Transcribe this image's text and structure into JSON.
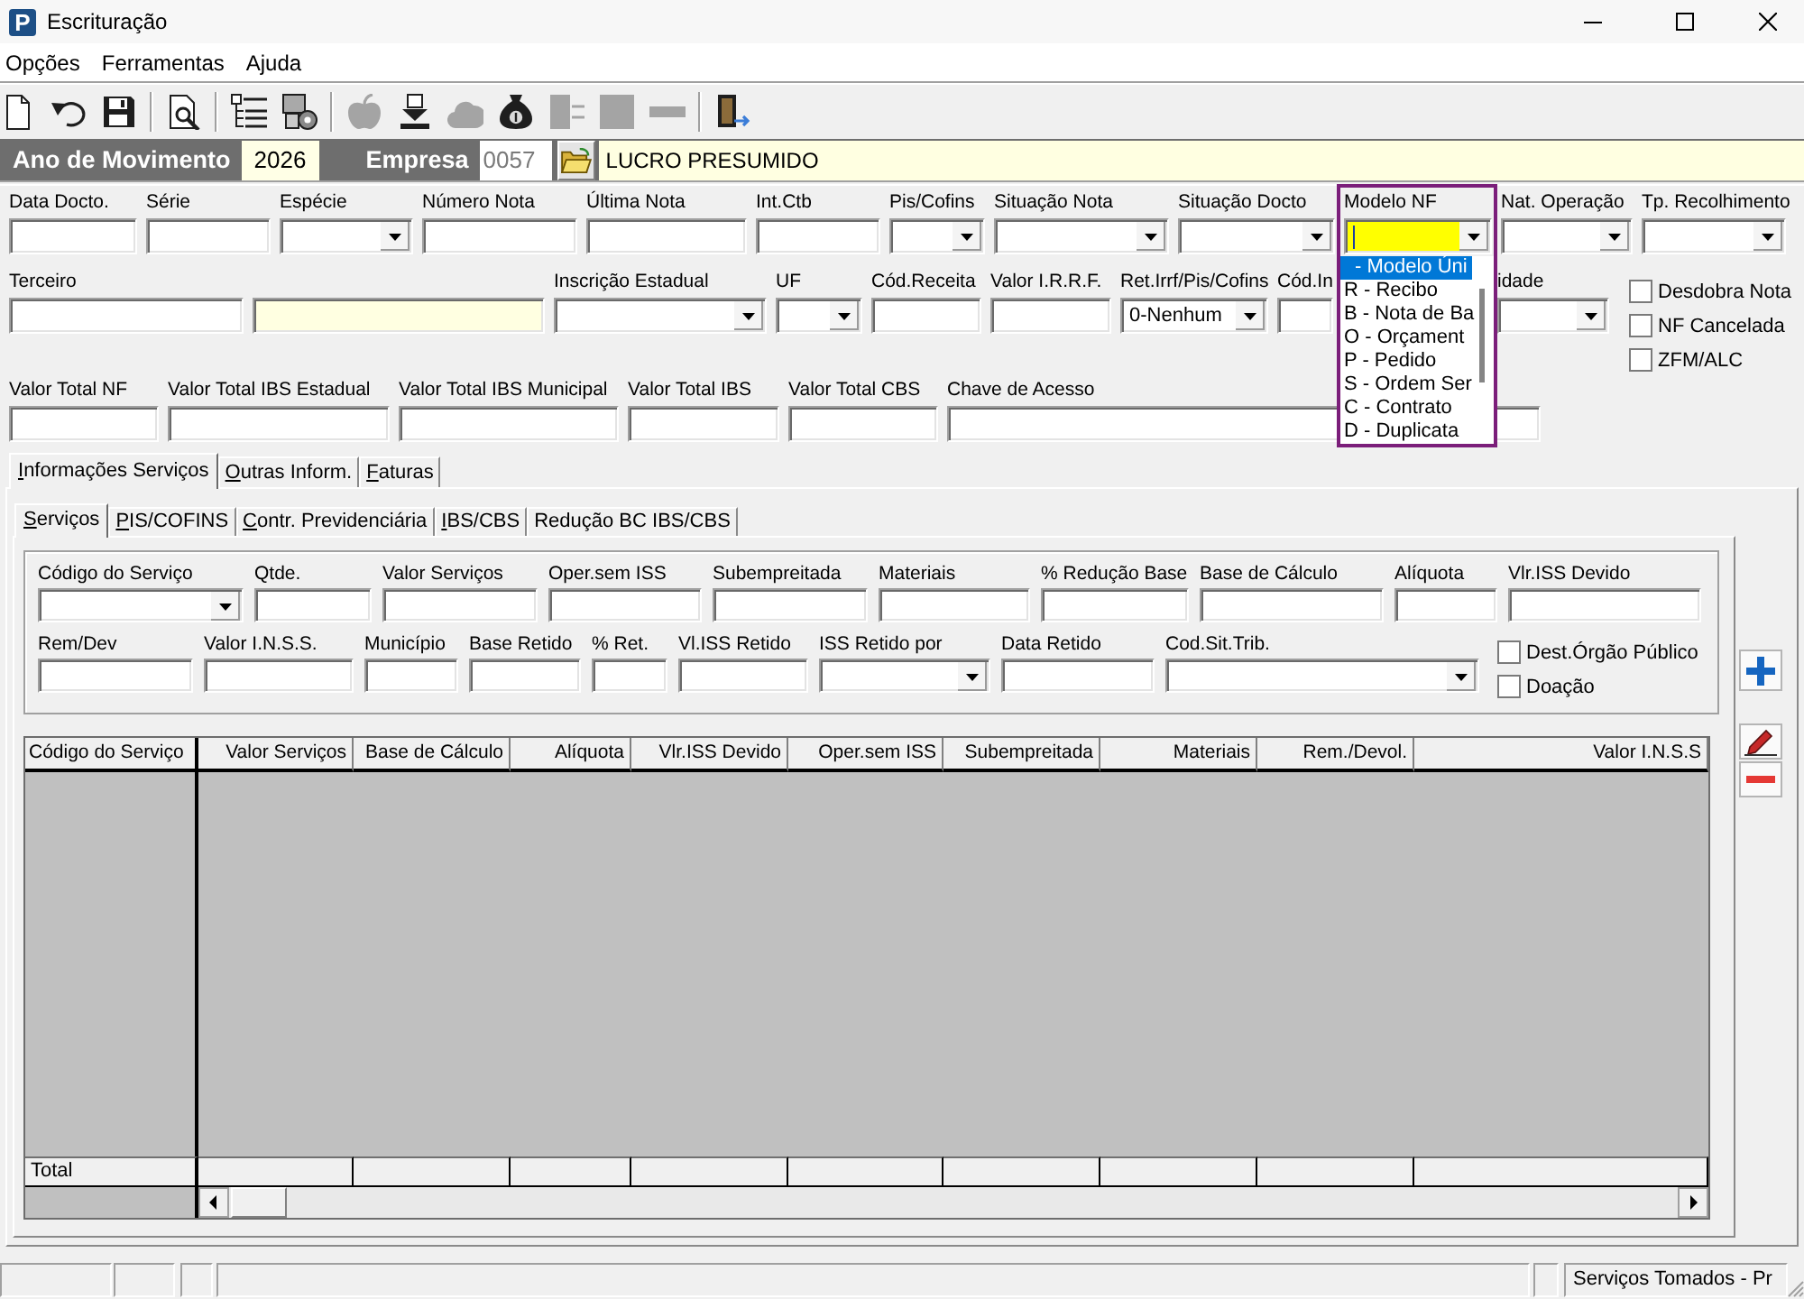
{
  "window": {
    "logo_text": "P",
    "title": "Escrituração"
  },
  "menu": [
    "Opções",
    "Ferramentas",
    "Ajuda"
  ],
  "toolbar": [
    [
      {
        "disabled": false
      },
      {
        "disabled": false
      },
      {
        "disabled": false
      }
    ],
    [
      {
        "disabled": false
      }
    ],
    [
      {
        "disabled": false
      },
      {
        "disabled": false
      }
    ],
    [
      {
        "disabled": true
      },
      {
        "disabled": false
      },
      {
        "disabled": true
      },
      {
        "disabled": false
      },
      {
        "disabled": true
      },
      {
        "disabled": true
      },
      {
        "disabled": true
      }
    ],
    [
      {
        "disabled": false
      }
    ]
  ],
  "header": {
    "year_label": "Ano de Movimento",
    "year": "2026",
    "company_label": "Empresa",
    "company_code": {
      "value": "0057",
      "disabled": true
    },
    "company_name": "LUCRO PRESUMIDO"
  },
  "form": {
    "row_1": [
      {
        "label": "Data Docto.",
        "kind": "text",
        "focused": false
      },
      {
        "label": "Série",
        "kind": "text",
        "focused": false
      },
      {
        "label": "Espécie",
        "kind": "combo",
        "focused": false
      },
      {
        "label": "Número Nota",
        "kind": "text",
        "focused": false
      },
      {
        "label": "Última Nota",
        "kind": "text",
        "focused": false
      },
      {
        "label": "Int.Ctb",
        "kind": "text",
        "focused": false
      },
      {
        "label": "Pis/Cofins",
        "kind": "combo",
        "focused": false
      },
      {
        "label": "Situação Nota",
        "kind": "combo",
        "focused": false
      },
      {
        "label": "Situação Docto",
        "kind": "combo",
        "focused": false
      },
      {
        "label": "Modelo NF",
        "kind": "combo",
        "focused": true,
        "list": {
          "framed": true,
          "options": [
            {
              "label": "- Modelo Úni",
              "selected": true
            },
            {
              "label": "R - Recibo",
              "selected": false
            },
            {
              "label": "B - Nota de Ba",
              "selected": false
            },
            {
              "label": "O - Orçament",
              "selected": false
            },
            {
              "label": "P - Pedido",
              "selected": false
            },
            {
              "label": "S - Ordem Ser",
              "selected": false
            },
            {
              "label": "C - Contrato",
              "selected": false
            },
            {
              "label": "D - Duplicata",
              "selected": false
            }
          ]
        }
      },
      {
        "label": "Nat. Operação",
        "kind": "combo",
        "focused": false
      },
      {
        "label": "Tp. Recolhimento",
        "kind": "combo",
        "focused": false
      }
    ],
    "row_2": [
      {
        "label": "Terceiro",
        "kind": "text",
        "focused": false
      },
      {
        "kind": "display",
        "focused": false
      },
      {
        "label": "Inscrição Estadual",
        "kind": "combo",
        "focused": false
      },
      {
        "label": "UF",
        "kind": "combo",
        "focused": false
      },
      {
        "label": "Cód.Receita",
        "kind": "text",
        "focused": false
      },
      {
        "label": "Valor I.R.R.F.",
        "kind": "text",
        "focused": false
      },
      {
        "label": "Ret.Irrf/Pis/Cofins",
        "kind": "combo",
        "value": "0-Nenhum",
        "focused": false
      },
      {
        "label": "Cód.In",
        "kind": "text",
        "focused": false
      },
      {
        "label": "idade",
        "kind": "combo",
        "focused": false
      }
    ],
    "flags": [
      {
        "label": "Desdobra Nota",
        "checked": false
      },
      {
        "label": "NF Cancelada",
        "checked": false
      },
      {
        "label": "ZFM/ALC",
        "checked": false
      }
    ],
    "row_3": [
      {
        "label": "Valor Total NF",
        "kind": "text",
        "focused": false
      },
      {
        "label": "Valor Total IBS Estadual",
        "kind": "text",
        "focused": false
      },
      {
        "label": "Valor Total IBS Municipal",
        "kind": "text",
        "focused": false
      },
      {
        "label": "Valor Total IBS",
        "kind": "text",
        "focused": false
      },
      {
        "label": "Valor Total CBS",
        "kind": "text",
        "focused": false
      },
      {
        "label": "Chave de Acesso",
        "kind": "text",
        "focused": false
      }
    ]
  },
  "tabs": [
    {
      "label": "Informações Serviços",
      "selected": true,
      "hotkey": true
    },
    {
      "label": "Outras Inform.",
      "selected": false,
      "hotkey": true
    },
    {
      "label": "Faturas",
      "selected": false,
      "hotkey": true
    }
  ],
  "sub_tabs": [
    {
      "label": "Serviços",
      "selected": true,
      "hotkey": true
    },
    {
      "label": "PIS/COFINS",
      "selected": false,
      "hotkey": true
    },
    {
      "label": "Contr. Previdenciária",
      "selected": false,
      "hotkey": true
    },
    {
      "label": "IBS/CBS",
      "selected": false,
      "hotkey": true
    },
    {
      "label": "Redução BC IBS/CBS",
      "selected": false,
      "hotkey": false
    }
  ],
  "service_form": {
    "row_1": [
      {
        "label": "Código do Serviço",
        "kind": "combo"
      },
      {
        "label": "Qtde.",
        "kind": "text"
      },
      {
        "label": "Valor Serviços",
        "kind": "text"
      },
      {
        "label": "Oper.sem ISS",
        "kind": "text"
      },
      {
        "label": "Subempreitada",
        "kind": "text"
      },
      {
        "label": "Materiais",
        "kind": "text"
      },
      {
        "label": "% Redução Base",
        "kind": "text"
      },
      {
        "label": "Base de Cálculo",
        "kind": "text"
      },
      {
        "label": "Alíquota",
        "kind": "text"
      },
      {
        "label": "Vlr.ISS Devido",
        "kind": "text"
      }
    ],
    "row_2": [
      {
        "label": "Rem/Dev",
        "kind": "text"
      },
      {
        "label": "Valor I.N.S.S.",
        "kind": "text"
      },
      {
        "label": "Município",
        "kind": "text"
      },
      {
        "label": "Base Retido",
        "kind": "text"
      },
      {
        "label": "% Ret.",
        "kind": "text"
      },
      {
        "label": "Vl.ISS Retido",
        "kind": "text"
      },
      {
        "label": "ISS Retido por",
        "kind": "combo"
      },
      {
        "label": "Data Retido",
        "kind": "text"
      },
      {
        "label": "Cod.Sit.Trib.",
        "kind": "combo"
      }
    ],
    "flags": [
      {
        "label": "Dest.Órgão Público",
        "checked": false
      },
      {
        "label": "Doação",
        "checked": false
      }
    ]
  },
  "grid": {
    "columns": [
      "Código do Serviço",
      "Valor Serviços",
      "Base de Cálculo",
      "Alíquota",
      "Vlr.ISS Devido",
      "Oper.sem ISS",
      "Subempreitada",
      "Materiais",
      "Rem./Devol.",
      "Valor I.N.S.S"
    ],
    "footer_label": "Total"
  },
  "status_bar": {
    "text": "Serviços Tomados - Pr"
  }
}
